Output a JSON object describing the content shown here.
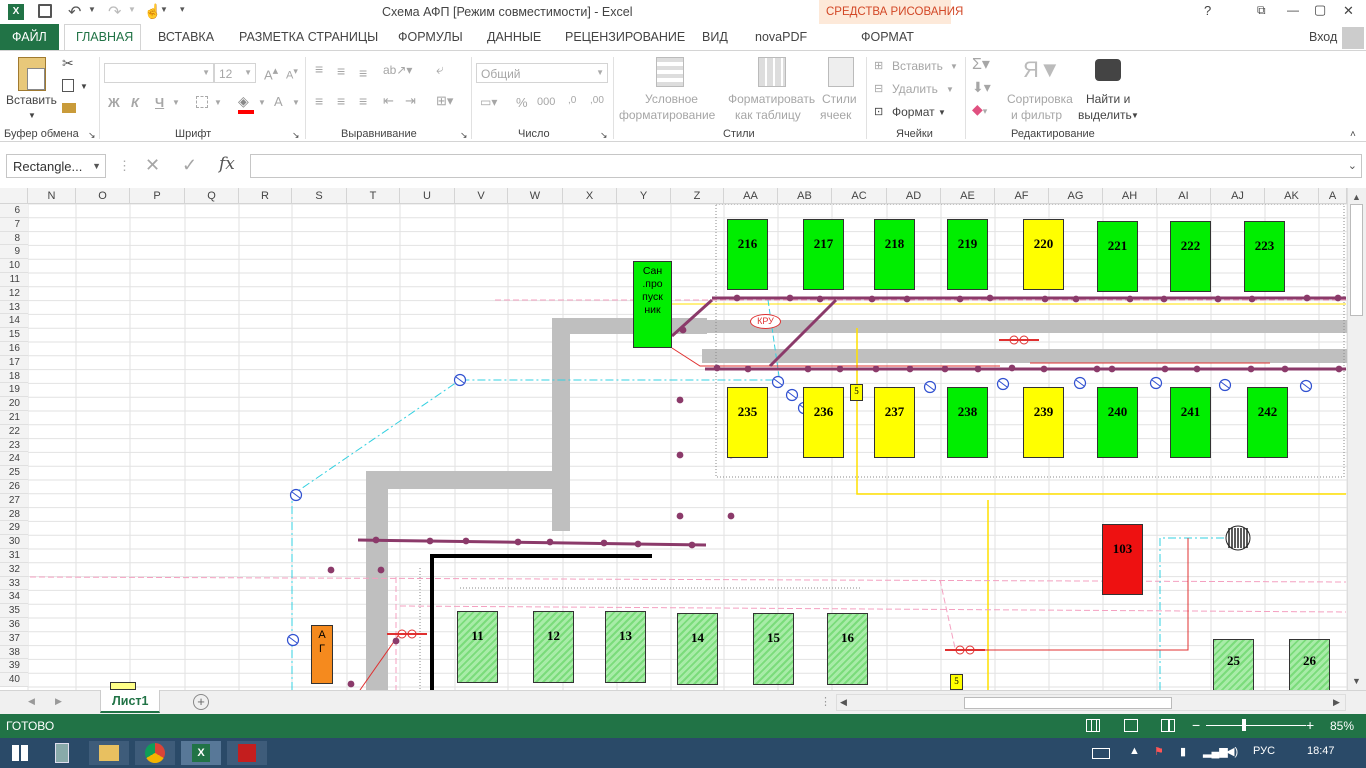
{
  "window": {
    "title": "Схема АФП  [Режим совместимости] - Excel",
    "context_tab_group": "СРЕДСТВА РИСОВАНИЯ",
    "help": "?",
    "restore": "⧉",
    "min": "—",
    "max": "▢",
    "close": "✕"
  },
  "ribbon_tabs": {
    "file": "ФАЙЛ",
    "home": "ГЛАВНАЯ",
    "insert": "ВСТАВКА",
    "layout": "РАЗМЕТКА СТРАНИЦЫ",
    "formulas": "ФОРМУЛЫ",
    "data": "ДАННЫЕ",
    "review": "РЕЦЕНЗИРОВАНИЕ",
    "view": "ВИД",
    "novapdf": "novaPDF",
    "format": "ФОРМАТ",
    "signin": "Вход"
  },
  "clipboard": {
    "paste": "Вставить",
    "group": "Буфер обмена"
  },
  "font": {
    "size": "12",
    "bold": "Ж",
    "italic": "К",
    "underline": "Ч",
    "group": "Шрифт"
  },
  "alignment": {
    "group": "Выравнивание"
  },
  "number": {
    "format": "Общий",
    "group": "Число"
  },
  "styles": {
    "cond1": "Условное",
    "cond2": "форматирование",
    "table1": "Форматировать",
    "table2": "как таблицу",
    "cell1": "Стили",
    "cell2": "ячеек",
    "group": "Стили"
  },
  "cells": {
    "insert": "Вставить",
    "delete": "Удалить",
    "format": "Формат",
    "group": "Ячейки"
  },
  "editing": {
    "sort1": "Сортировка",
    "sort2": "и фильтр",
    "find1": "Найти и",
    "find2": "выделить",
    "group": "Редактирование"
  },
  "formula_bar": {
    "name_box": "Rectangle...",
    "fx": "fx",
    "cancel": "✕",
    "enter": "✓",
    "value": ""
  },
  "columns": [
    "N",
    "O",
    "P",
    "Q",
    "R",
    "S",
    "T",
    "U",
    "V",
    "W",
    "X",
    "Y",
    "Z",
    "AA",
    "AB",
    "AC",
    "AD",
    "AE",
    "AF",
    "AG",
    "AH",
    "AI",
    "AJ",
    "AK",
    "A"
  ],
  "rows": [
    "6",
    "7",
    "8",
    "9",
    "10",
    "11",
    "12",
    "13",
    "14",
    "15",
    "16",
    "17",
    "18",
    "19",
    "20",
    "21",
    "22",
    "23",
    "24",
    "25",
    "26",
    "27",
    "28",
    "29",
    "30",
    "31",
    "32",
    "33",
    "34",
    "35",
    "36",
    "37",
    "38",
    "39",
    "40"
  ],
  "diagram": {
    "top_boxes": [
      {
        "label": "216",
        "color": "#00ee00"
      },
      {
        "label": "217",
        "color": "#00ee00"
      },
      {
        "label": "218",
        "color": "#00ee00"
      },
      {
        "label": "219",
        "color": "#00ee00"
      },
      {
        "label": "220",
        "color": "#ffff00"
      },
      {
        "label": "221",
        "color": "#00ee00"
      },
      {
        "label": "222",
        "color": "#00ee00"
      },
      {
        "label": "223",
        "color": "#00ee00"
      }
    ],
    "mid_boxes": [
      {
        "label": "235",
        "color": "#ffff00"
      },
      {
        "label": "236",
        "color": "#ffff00"
      },
      {
        "label": "237",
        "color": "#ffff00"
      },
      {
        "label": "238",
        "color": "#00ee00"
      },
      {
        "label": "239",
        "color": "#ffff00"
      },
      {
        "label": "240",
        "color": "#00ee00"
      },
      {
        "label": "241",
        "color": "#00ee00"
      },
      {
        "label": "242",
        "color": "#00ee00"
      }
    ],
    "bottom_boxes": [
      "11",
      "12",
      "13",
      "14",
      "15",
      "16"
    ],
    "right_boxes": [
      "25",
      "26"
    ],
    "red_box": "103",
    "san_label": "Сан .про пуск ник",
    "kru_label": "КРУ",
    "ag_label": "А Г",
    "small5": "5",
    "small5b": "5"
  },
  "sheet_tab": "Лист1",
  "status": {
    "ready": "ГОТОВО",
    "zoom": "85%",
    "minus": "−",
    "plus": "+"
  },
  "taskbar": {
    "lang": "РУС",
    "time": "18:47"
  }
}
